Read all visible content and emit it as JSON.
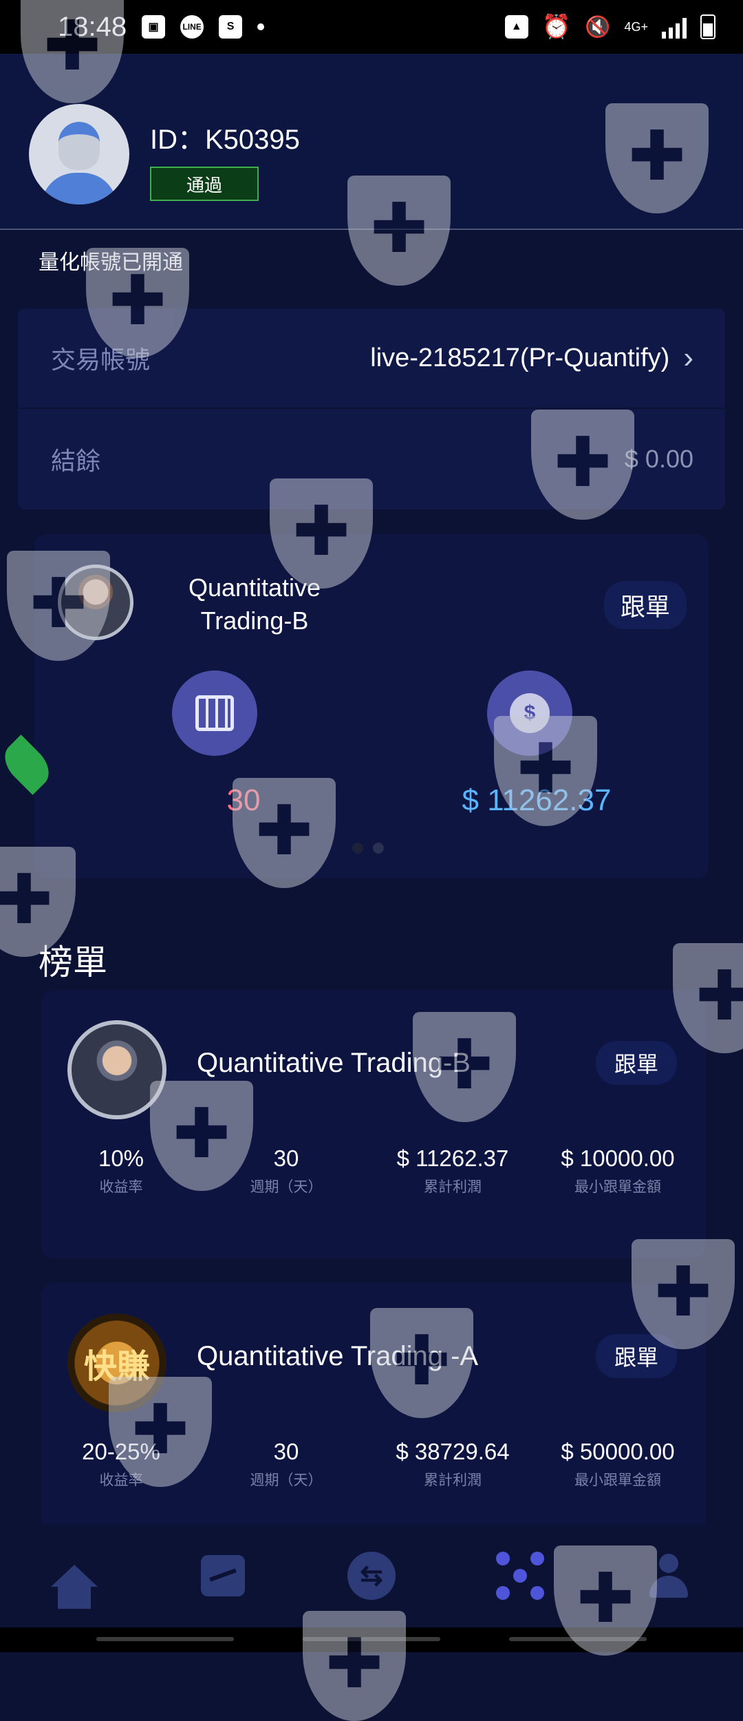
{
  "status_bar": {
    "time": "18:48",
    "notification_icons": [
      "image-icon",
      "line-icon",
      "shopping-bag-icon"
    ],
    "network": "4G+"
  },
  "profile": {
    "id_text": "ID：K50395",
    "status": "通過"
  },
  "notice": "量化帳號已開通",
  "account": {
    "trade_label": "交易帳號",
    "trade_value": "live-2185217(Pr-Quantify)",
    "balance_label": "結餘",
    "balance_value": "$ 0.00"
  },
  "featured": {
    "name": "Quantitative Trading-B",
    "follow": "跟單",
    "days": "30",
    "profit": "$ 11262.37"
  },
  "leaderboard": {
    "title": "榜單",
    "items": [
      {
        "name": "Quantitative Trading-B",
        "follow": "跟單",
        "stats": [
          {
            "value": "10%",
            "label": "收益率"
          },
          {
            "value": "30",
            "label": "週期（天）"
          },
          {
            "value": "$ 11262.37",
            "label": "累計利潤"
          },
          {
            "value": "$ 10000.00",
            "label": "最小跟單金額"
          }
        ]
      },
      {
        "name": "Quantitative Trading -A",
        "follow": "跟單",
        "avatar_text": "快賺",
        "stats": [
          {
            "value": "20-25%",
            "label": "收益率"
          },
          {
            "value": "30",
            "label": "週期（天）"
          },
          {
            "value": "$ 38729.64",
            "label": "累計利潤"
          },
          {
            "value": "$ 50000.00",
            "label": "最小跟單金額"
          }
        ]
      }
    ]
  },
  "bottom_nav": [
    "home-icon",
    "chart-icon",
    "exchange-icon",
    "network-icon",
    "user-icon"
  ],
  "colors": {
    "background": "#0b1233",
    "accent_red": "#ff6f7e",
    "accent_blue": "#5ab4ff",
    "active_nav": "#4f55d8"
  }
}
